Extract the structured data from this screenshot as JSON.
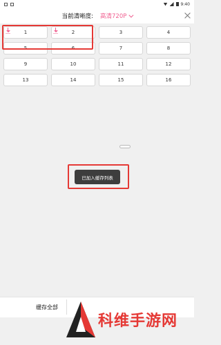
{
  "status_bar": {
    "time": "9:40"
  },
  "header": {
    "quality_label": "当前清晰度:",
    "quality_value": "高清720P"
  },
  "episodes": [
    "1",
    "2",
    "3",
    "4",
    "5",
    "6",
    "7",
    "8",
    "9",
    "10",
    "11",
    "12",
    "13",
    "14",
    "15",
    "16"
  ],
  "downloaded_episodes": [
    "1",
    "2"
  ],
  "toast": {
    "message": "已加入缓存列表"
  },
  "bottom": {
    "cache_all_label": "缓存全部"
  },
  "watermark": {
    "text": "科维手游网"
  },
  "colors": {
    "accent": "#f06292",
    "highlight": "#e53935",
    "toast_bg": "#3d3d3d"
  },
  "icons": [
    "close-icon",
    "chevron-down-icon",
    "download-icon",
    "wifi-icon",
    "signal-icon",
    "battery-icon"
  ]
}
